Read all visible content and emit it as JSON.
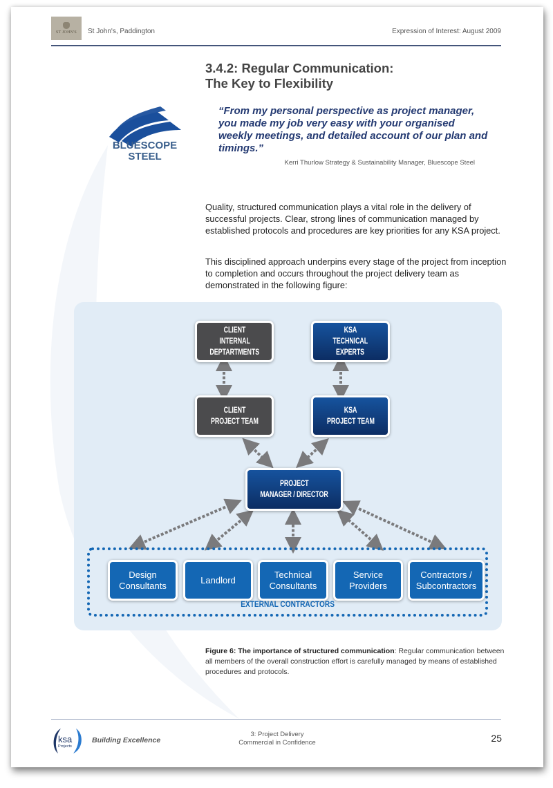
{
  "header": {
    "logo_text": "ST JOHN'S",
    "left_text": "St John's, Paddington",
    "right_text": "Expression of Interest: August 2009"
  },
  "title": {
    "line1": "3.4.2: Regular Communication:",
    "line2": "The Key to Flexibility"
  },
  "logo": {
    "name_line1": "BLUESCOPE",
    "name_line2": "STEEL"
  },
  "quote": {
    "text": "“From my personal perspective as project manager, you made my job very easy with your organised weekly meetings, and detailed account of our plan and timings.”",
    "attribution": "Kerri Thurlow Strategy & Sustainability Manager, Bluescope Steel"
  },
  "body": {
    "paragraph1": "Quality, structured communication plays a vital role in the delivery of successful projects. Clear, strong lines of communication managed by established protocols and procedures are key priorities for any KSA project.",
    "paragraph2": "This disciplined approach underpins every stage of the project from inception to completion and occurs throughout the project delivery team as demonstrated in the following figure:"
  },
  "diagram": {
    "client_internal": "CLIENT INTERNAL DEPTARTMENTS",
    "client_internal_lines": [
      "CLIENT",
      "INTERNAL",
      "DEPTARTMENTS"
    ],
    "ksa_technical_lines": [
      "KSA",
      "TECHNICAL",
      "EXPERTS"
    ],
    "client_team_lines": [
      "CLIENT",
      "PROJECT TEAM"
    ],
    "ksa_team_lines": [
      "KSA",
      "PROJECT TEAM"
    ],
    "manager_lines": [
      "PROJECT",
      "MANAGER / DIRECTOR"
    ],
    "external": [
      {
        "line1": "Design",
        "line2": "Consultants"
      },
      {
        "line1": "Landlord",
        "line2": ""
      },
      {
        "line1": "Technical",
        "line2": "Consultants"
      },
      {
        "line1": "Service",
        "line2": "Providers"
      },
      {
        "line1": "Contractors /",
        "line2": "Subcontractors"
      }
    ],
    "external_label": "EXTERNAL CONTRACTORS",
    "colors": {
      "client": "#4b4b4d",
      "ksa": "#0c2d63",
      "external": "#1467b4",
      "arrow": "#7a7a7c",
      "panel": "#e1ecf6"
    }
  },
  "caption": {
    "bold": "Figure 6: The importance of structured communication",
    "text": ": Regular communication between all members of the overall construction effort is carefully managed by means of established procedures and protocols."
  },
  "footer": {
    "logo_text": "ksa",
    "logo_sub": "Projects",
    "tagline": "Building Excellence",
    "section": "3: Project Delivery",
    "confidentiality": "Commercial in Confidence",
    "page_number": "25"
  }
}
